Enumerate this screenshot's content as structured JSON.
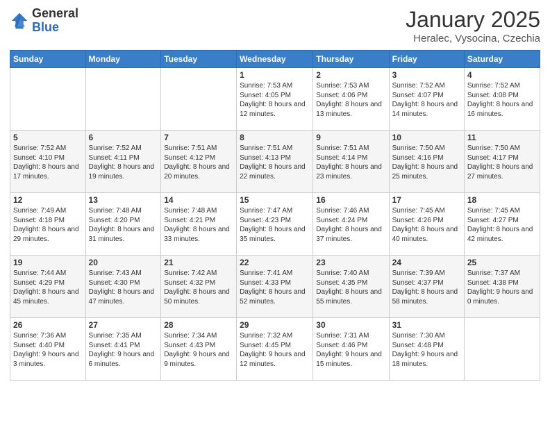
{
  "logo": {
    "general": "General",
    "blue": "Blue"
  },
  "title": "January 2025",
  "location": "Heralec, Vysocina, Czechia",
  "days_of_week": [
    "Sunday",
    "Monday",
    "Tuesday",
    "Wednesday",
    "Thursday",
    "Friday",
    "Saturday"
  ],
  "weeks": [
    [
      {
        "day": "",
        "info": ""
      },
      {
        "day": "",
        "info": ""
      },
      {
        "day": "",
        "info": ""
      },
      {
        "day": "1",
        "info": "Sunrise: 7:53 AM\nSunset: 4:05 PM\nDaylight: 8 hours and 12 minutes."
      },
      {
        "day": "2",
        "info": "Sunrise: 7:53 AM\nSunset: 4:06 PM\nDaylight: 8 hours and 13 minutes."
      },
      {
        "day": "3",
        "info": "Sunrise: 7:52 AM\nSunset: 4:07 PM\nDaylight: 8 hours and 14 minutes."
      },
      {
        "day": "4",
        "info": "Sunrise: 7:52 AM\nSunset: 4:08 PM\nDaylight: 8 hours and 16 minutes."
      }
    ],
    [
      {
        "day": "5",
        "info": "Sunrise: 7:52 AM\nSunset: 4:10 PM\nDaylight: 8 hours and 17 minutes."
      },
      {
        "day": "6",
        "info": "Sunrise: 7:52 AM\nSunset: 4:11 PM\nDaylight: 8 hours and 19 minutes."
      },
      {
        "day": "7",
        "info": "Sunrise: 7:51 AM\nSunset: 4:12 PM\nDaylight: 8 hours and 20 minutes."
      },
      {
        "day": "8",
        "info": "Sunrise: 7:51 AM\nSunset: 4:13 PM\nDaylight: 8 hours and 22 minutes."
      },
      {
        "day": "9",
        "info": "Sunrise: 7:51 AM\nSunset: 4:14 PM\nDaylight: 8 hours and 23 minutes."
      },
      {
        "day": "10",
        "info": "Sunrise: 7:50 AM\nSunset: 4:16 PM\nDaylight: 8 hours and 25 minutes."
      },
      {
        "day": "11",
        "info": "Sunrise: 7:50 AM\nSunset: 4:17 PM\nDaylight: 8 hours and 27 minutes."
      }
    ],
    [
      {
        "day": "12",
        "info": "Sunrise: 7:49 AM\nSunset: 4:18 PM\nDaylight: 8 hours and 29 minutes."
      },
      {
        "day": "13",
        "info": "Sunrise: 7:48 AM\nSunset: 4:20 PM\nDaylight: 8 hours and 31 minutes."
      },
      {
        "day": "14",
        "info": "Sunrise: 7:48 AM\nSunset: 4:21 PM\nDaylight: 8 hours and 33 minutes."
      },
      {
        "day": "15",
        "info": "Sunrise: 7:47 AM\nSunset: 4:23 PM\nDaylight: 8 hours and 35 minutes."
      },
      {
        "day": "16",
        "info": "Sunrise: 7:46 AM\nSunset: 4:24 PM\nDaylight: 8 hours and 37 minutes."
      },
      {
        "day": "17",
        "info": "Sunrise: 7:45 AM\nSunset: 4:26 PM\nDaylight: 8 hours and 40 minutes."
      },
      {
        "day": "18",
        "info": "Sunrise: 7:45 AM\nSunset: 4:27 PM\nDaylight: 8 hours and 42 minutes."
      }
    ],
    [
      {
        "day": "19",
        "info": "Sunrise: 7:44 AM\nSunset: 4:29 PM\nDaylight: 8 hours and 45 minutes."
      },
      {
        "day": "20",
        "info": "Sunrise: 7:43 AM\nSunset: 4:30 PM\nDaylight: 8 hours and 47 minutes."
      },
      {
        "day": "21",
        "info": "Sunrise: 7:42 AM\nSunset: 4:32 PM\nDaylight: 8 hours and 50 minutes."
      },
      {
        "day": "22",
        "info": "Sunrise: 7:41 AM\nSunset: 4:33 PM\nDaylight: 8 hours and 52 minutes."
      },
      {
        "day": "23",
        "info": "Sunrise: 7:40 AM\nSunset: 4:35 PM\nDaylight: 8 hours and 55 minutes."
      },
      {
        "day": "24",
        "info": "Sunrise: 7:39 AM\nSunset: 4:37 PM\nDaylight: 8 hours and 58 minutes."
      },
      {
        "day": "25",
        "info": "Sunrise: 7:37 AM\nSunset: 4:38 PM\nDaylight: 9 hours and 0 minutes."
      }
    ],
    [
      {
        "day": "26",
        "info": "Sunrise: 7:36 AM\nSunset: 4:40 PM\nDaylight: 9 hours and 3 minutes."
      },
      {
        "day": "27",
        "info": "Sunrise: 7:35 AM\nSunset: 4:41 PM\nDaylight: 9 hours and 6 minutes."
      },
      {
        "day": "28",
        "info": "Sunrise: 7:34 AM\nSunset: 4:43 PM\nDaylight: 9 hours and 9 minutes."
      },
      {
        "day": "29",
        "info": "Sunrise: 7:32 AM\nSunset: 4:45 PM\nDaylight: 9 hours and 12 minutes."
      },
      {
        "day": "30",
        "info": "Sunrise: 7:31 AM\nSunset: 4:46 PM\nDaylight: 9 hours and 15 minutes."
      },
      {
        "day": "31",
        "info": "Sunrise: 7:30 AM\nSunset: 4:48 PM\nDaylight: 9 hours and 18 minutes."
      },
      {
        "day": "",
        "info": ""
      }
    ]
  ]
}
